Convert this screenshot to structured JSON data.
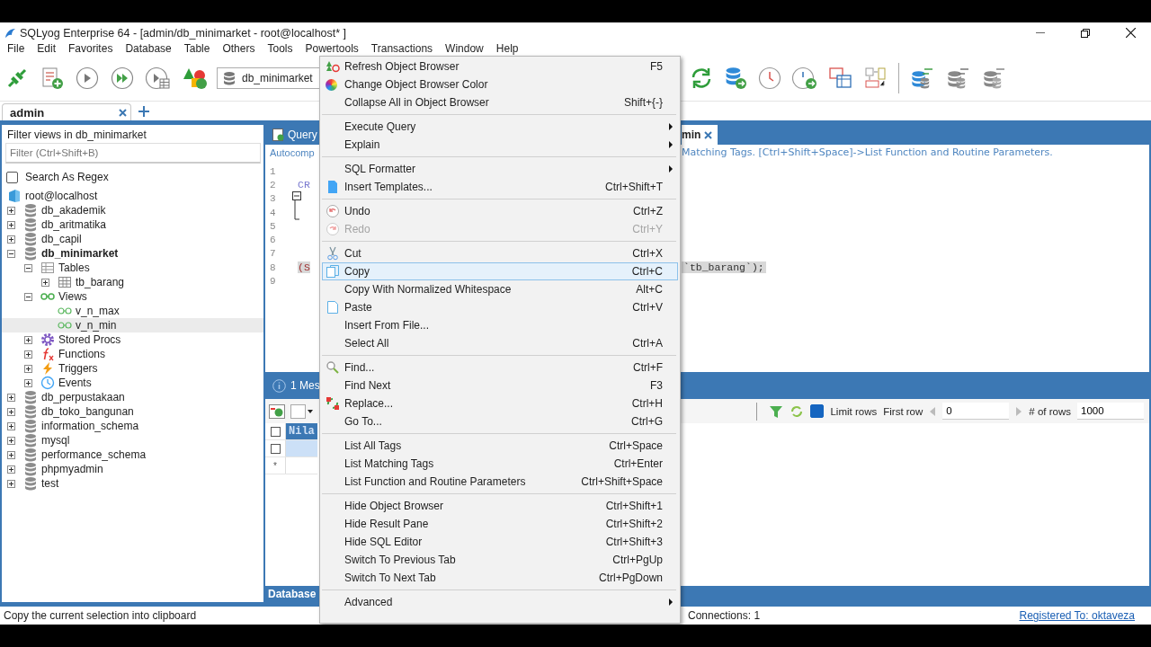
{
  "window": {
    "title": "SQLyog Enterprise 64 - [admin/db_minimarket - root@localhost* ]"
  },
  "menu_bar": [
    "File",
    "Edit",
    "Favorites",
    "Database",
    "Table",
    "Others",
    "Tools",
    "Powertools",
    "Transactions",
    "Window",
    "Help"
  ],
  "toolbar": {
    "database": "db_minimarket"
  },
  "connection_tabs": [
    {
      "label": "admin",
      "selected": true
    }
  ],
  "object_browser": {
    "title": "Filter views in db_minimarket",
    "filter_placeholder": "Filter (Ctrl+Shift+B)",
    "regex": {
      "label": "Search As Regex",
      "checked": false
    },
    "tree": [
      {
        "label": "root@localhost",
        "kind": "server",
        "selected": false,
        "children": [
          {
            "label": "db_akademik",
            "kind": "database",
            "expanded": false,
            "active": false,
            "selected": false
          },
          {
            "label": "db_aritmatika",
            "kind": "database",
            "expanded": false,
            "active": false,
            "selected": false
          },
          {
            "label": "db_capil",
            "kind": "database",
            "expanded": false,
            "active": false,
            "selected": false
          },
          {
            "label": "db_minimarket",
            "kind": "database",
            "expanded": true,
            "active": true,
            "selected": false,
            "children": [
              {
                "label": "Tables",
                "kind": "tables",
                "expanded": true,
                "selected": false,
                "children": [
                  {
                    "label": "tb_barang",
                    "kind": "table",
                    "expanded": false,
                    "selected": false
                  }
                ]
              },
              {
                "label": "Views",
                "kind": "views",
                "expanded": true,
                "selected": false,
                "children": [
                  {
                    "label": "v_n_max",
                    "kind": "view",
                    "selected": false
                  },
                  {
                    "label": "v_n_min",
                    "kind": "view",
                    "selected": true
                  }
                ]
              },
              {
                "label": "Stored Procs",
                "kind": "procs",
                "expanded": false,
                "selected": false
              },
              {
                "label": "Functions",
                "kind": "functions",
                "expanded": false,
                "selected": false
              },
              {
                "label": "Triggers",
                "kind": "triggers",
                "expanded": false,
                "selected": false
              },
              {
                "label": "Events",
                "kind": "events",
                "expanded": false,
                "selected": false
              }
            ]
          },
          {
            "label": "db_perpustakaan",
            "kind": "database",
            "expanded": false,
            "active": false,
            "selected": false
          },
          {
            "label": "db_toko_bangunan",
            "kind": "database",
            "expanded": false,
            "active": false,
            "selected": false
          },
          {
            "label": "information_schema",
            "kind": "database",
            "expanded": false,
            "active": false,
            "selected": false
          },
          {
            "label": "mysql",
            "kind": "database",
            "expanded": false,
            "active": false,
            "selected": false
          },
          {
            "label": "performance_schema",
            "kind": "database",
            "expanded": false,
            "active": false,
            "selected": false
          },
          {
            "label": "phpmyadmin",
            "kind": "database",
            "expanded": false,
            "active": false,
            "selected": false
          },
          {
            "label": "test",
            "kind": "database",
            "expanded": false,
            "active": false,
            "selected": false
          }
        ]
      }
    ]
  },
  "query_tabs": [
    {
      "label": "Query",
      "selected": false
    },
    {
      "label": "min",
      "selected": true
    }
  ],
  "editor": {
    "hint_start": "Autocomp",
    "hint_end": "Matching Tags. [Ctrl+Shift+Space]->List Function and Routine Parameters.",
    "lines": [
      {
        "number": "1"
      },
      {
        "number": "2",
        "code": "CR"
      },
      {
        "number": "3"
      },
      {
        "number": "4"
      },
      {
        "number": "5"
      },
      {
        "number": "6"
      },
      {
        "number": "7"
      },
      {
        "number": "8",
        "selection_start": "(S",
        "selection_end": "`tb_barang`);"
      },
      {
        "number": "9"
      }
    ]
  },
  "messages_tab": "1 Mes",
  "results": {
    "limit_rows": {
      "label": "Limit rows",
      "checked": true
    },
    "first_row_label": "First row",
    "first_row": "0",
    "rows_label": "# of rows",
    "rows": "1000",
    "grid": {
      "column": "Nila",
      "all_checked": false,
      "rows": [
        {
          "checked": false,
          "selected": true
        }
      ],
      "new_row_marker": "*"
    }
  },
  "bottom_tab": "Database",
  "context_menu": {
    "groups": [
      {
        "items": [
          {
            "label": "Refresh Object Browser",
            "shortcut": "F5",
            "kind": "refresh",
            "submenu": false,
            "disabled": false,
            "selected": false
          },
          {
            "label": "Change Object Browser Color",
            "kind": "color",
            "submenu": false,
            "disabled": false,
            "selected": false
          },
          {
            "label": "Collapse All in Object Browser",
            "shortcut": "Shift+{-}",
            "kind": "plain",
            "submenu": false,
            "disabled": false,
            "selected": false
          }
        ]
      },
      {
        "items": [
          {
            "label": "Execute Query",
            "kind": "plain",
            "submenu": true,
            "disabled": false,
            "selected": false
          },
          {
            "label": "Explain",
            "kind": "plain",
            "submenu": true,
            "disabled": false,
            "selected": false
          }
        ]
      },
      {
        "items": [
          {
            "label": "SQL Formatter",
            "kind": "plain",
            "submenu": true,
            "disabled": false,
            "selected": false
          },
          {
            "label": "Insert Templates...",
            "shortcut": "Ctrl+Shift+T",
            "kind": "template",
            "submenu": false,
            "disabled": false,
            "selected": false
          }
        ]
      },
      {
        "items": [
          {
            "label": "Undo",
            "shortcut": "Ctrl+Z",
            "kind": "undo",
            "submenu": false,
            "disabled": false,
            "selected": false
          },
          {
            "label": "Redo",
            "shortcut": "Ctrl+Y",
            "kind": "redo",
            "submenu": false,
            "disabled": true,
            "selected": false
          }
        ]
      },
      {
        "items": [
          {
            "label": "Cut",
            "shortcut": "Ctrl+X",
            "kind": "cut",
            "submenu": false,
            "disabled": false,
            "selected": false
          },
          {
            "label": "Copy",
            "shortcut": "Ctrl+C",
            "kind": "copy",
            "submenu": false,
            "disabled": false,
            "selected": true
          },
          {
            "label": "Copy With Normalized Whitespace",
            "shortcut": "Alt+C",
            "kind": "plain",
            "submenu": false,
            "disabled": false,
            "selected": false
          },
          {
            "label": "Paste",
            "shortcut": "Ctrl+V",
            "kind": "paste",
            "submenu": false,
            "disabled": false,
            "selected": false
          },
          {
            "label": "Insert From File...",
            "kind": "plain",
            "submenu": false,
            "disabled": false,
            "selected": false
          },
          {
            "label": "Select All",
            "shortcut": "Ctrl+A",
            "kind": "plain",
            "submenu": false,
            "disabled": false,
            "selected": false
          }
        ]
      },
      {
        "items": [
          {
            "label": "Find...",
            "shortcut": "Ctrl+F",
            "kind": "find",
            "submenu": false,
            "disabled": false,
            "selected": false
          },
          {
            "label": "Find Next",
            "shortcut": "F3",
            "kind": "plain",
            "submenu": false,
            "disabled": false,
            "selected": false
          },
          {
            "label": "Replace...",
            "shortcut": "Ctrl+H",
            "kind": "replace",
            "submenu": false,
            "disabled": false,
            "selected": false
          },
          {
            "label": "Go To...",
            "shortcut": "Ctrl+G",
            "kind": "plain",
            "submenu": false,
            "disabled": false,
            "selected": false
          }
        ]
      },
      {
        "items": [
          {
            "label": "List All Tags",
            "shortcut": "Ctrl+Space",
            "kind": "plain",
            "submenu": false,
            "disabled": false,
            "selected": false
          },
          {
            "label": "List Matching Tags",
            "shortcut": "Ctrl+Enter",
            "kind": "plain",
            "submenu": false,
            "disabled": false,
            "selected": false
          },
          {
            "label": "List Function and Routine Parameters",
            "shortcut": "Ctrl+Shift+Space",
            "kind": "plain",
            "submenu": false,
            "disabled": false,
            "selected": false
          }
        ]
      },
      {
        "items": [
          {
            "label": "Hide Object Browser",
            "shortcut": "Ctrl+Shift+1",
            "kind": "plain",
            "submenu": false,
            "disabled": false,
            "selected": false
          },
          {
            "label": "Hide Result Pane",
            "shortcut": "Ctrl+Shift+2",
            "kind": "plain",
            "submenu": false,
            "disabled": false,
            "selected": false
          },
          {
            "label": "Hide SQL Editor",
            "shortcut": "Ctrl+Shift+3",
            "kind": "plain",
            "submenu": false,
            "disabled": false,
            "selected": false
          },
          {
            "label": "Switch To Previous Tab",
            "shortcut": "Ctrl+PgUp",
            "kind": "plain",
            "submenu": false,
            "disabled": false,
            "selected": false
          },
          {
            "label": "Switch To Next Tab",
            "shortcut": "Ctrl+PgDown",
            "kind": "plain",
            "submenu": false,
            "disabled": false,
            "selected": false
          }
        ]
      },
      {
        "items": [
          {
            "label": "Advanced",
            "kind": "plain",
            "submenu": true,
            "disabled": false,
            "selected": false
          }
        ]
      }
    ]
  },
  "status_bar": {
    "message": "Copy the current selection into clipboard",
    "connections": "Connections: 1",
    "registration": "Registered To: oktaveza"
  }
}
